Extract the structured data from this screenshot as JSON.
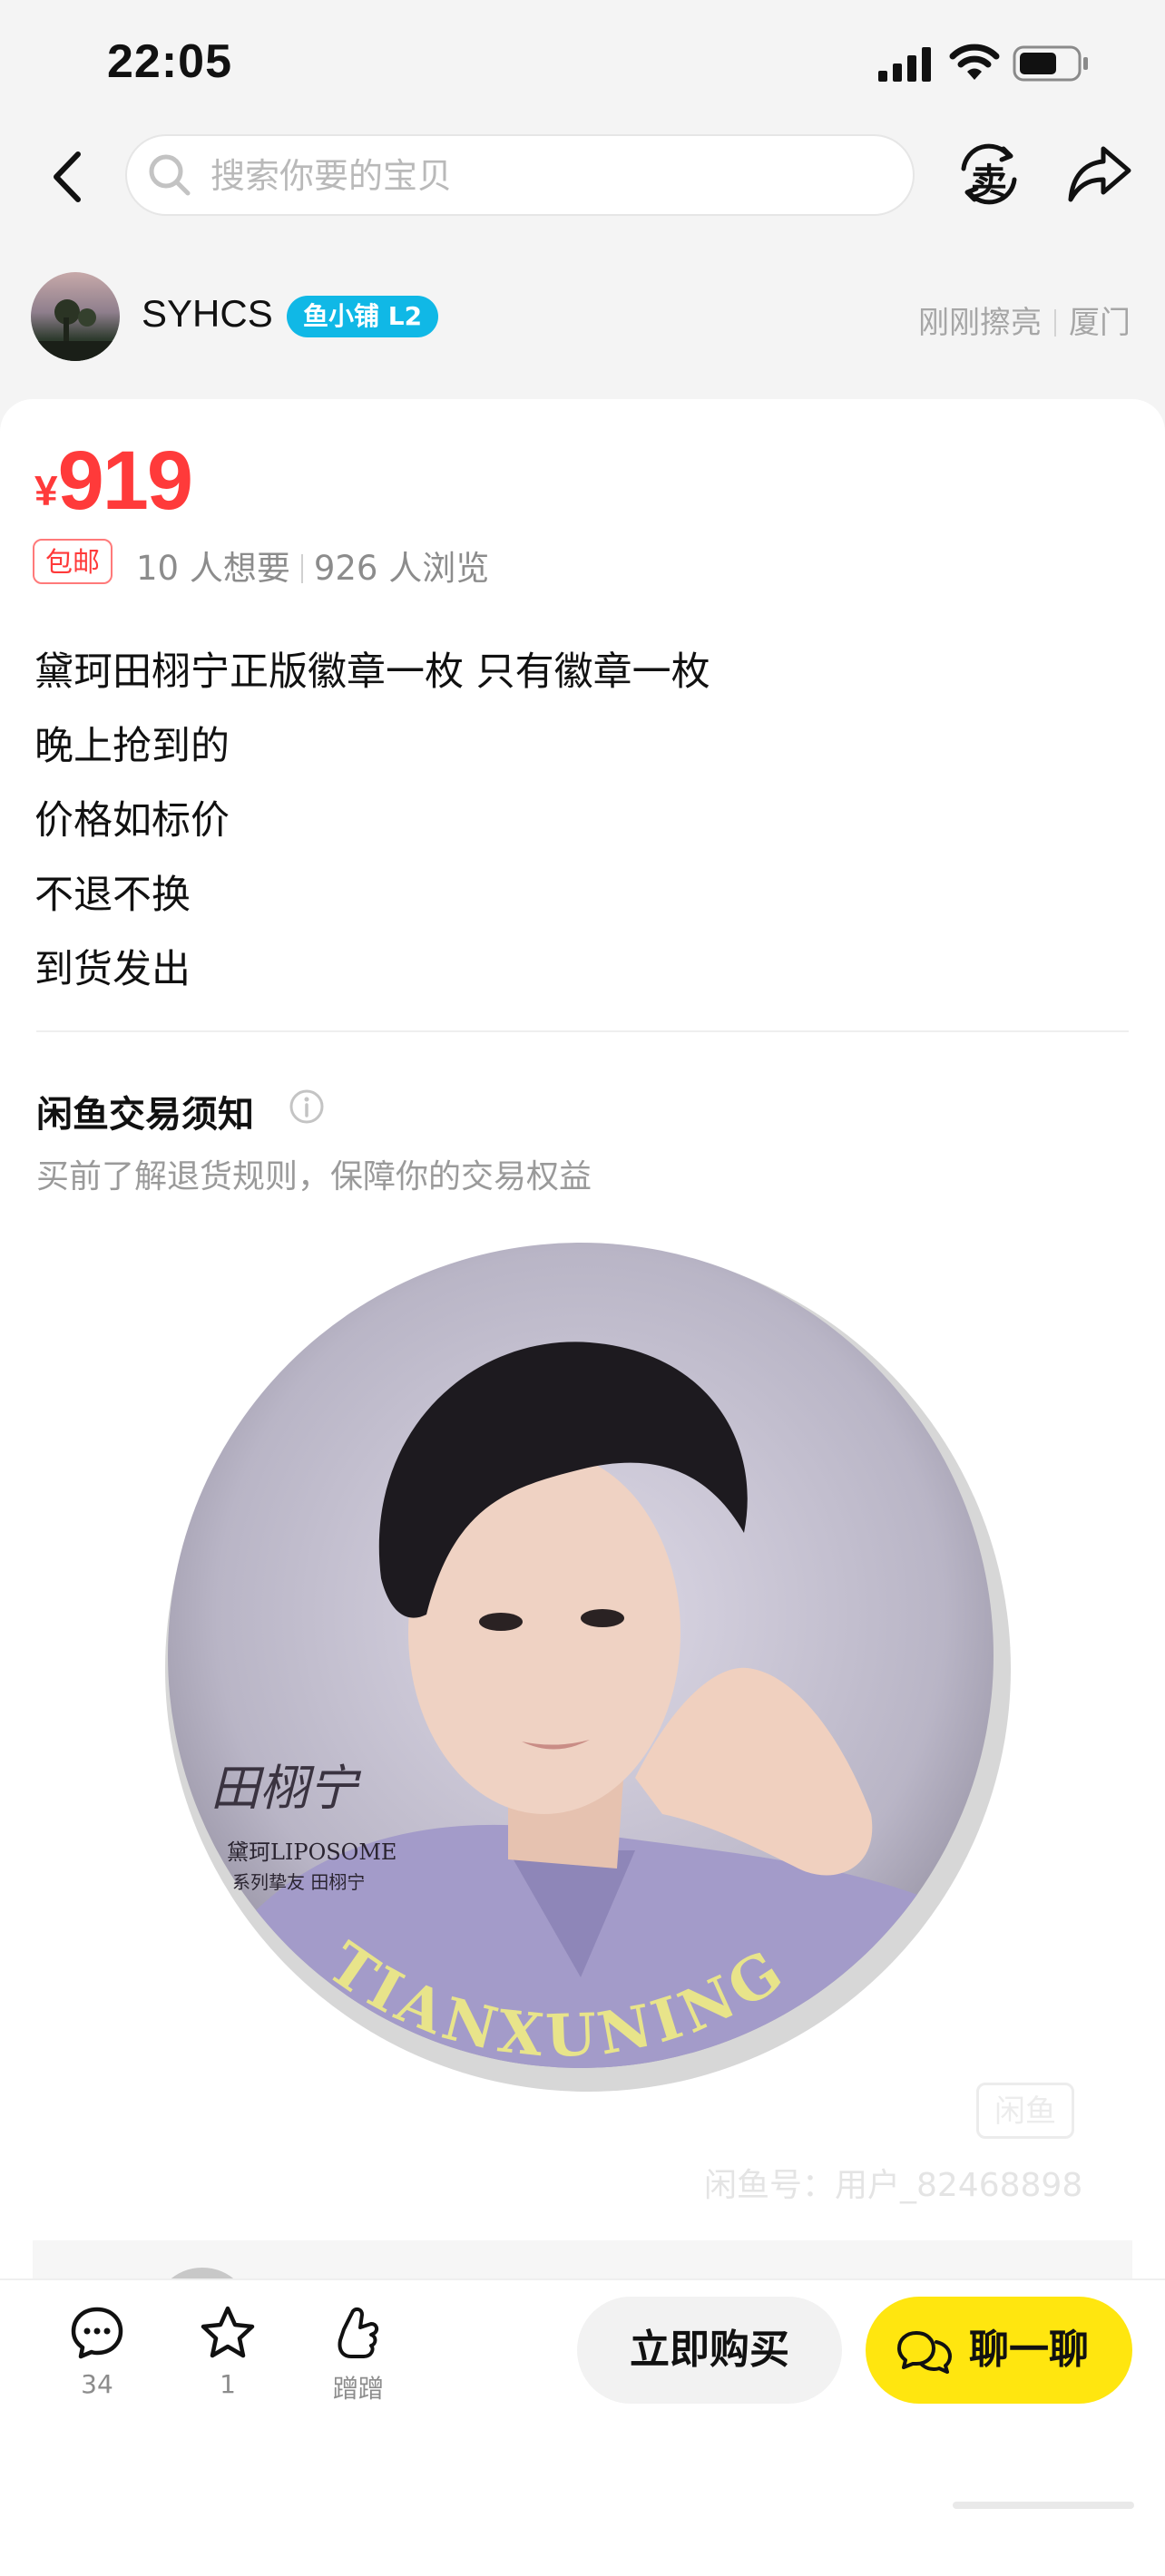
{
  "status_bar": {
    "time": "22:05"
  },
  "nav": {
    "search_placeholder": "搜索你要的宝贝",
    "sell_icon_text": "卖"
  },
  "seller": {
    "name": "SYHCS",
    "badge": "鱼小铺 L2",
    "refresh_status": "刚刚擦亮",
    "location": "厦门"
  },
  "product": {
    "currency": "¥",
    "price": "919",
    "shipping_tag": "包邮",
    "want_count": "10 人想要",
    "view_count": "926 人浏览",
    "description": [
      "黛珂田栩宁正版徽章一枚 只有徽章一枚",
      "晚上抢到的",
      "价格如标价",
      "不退不换",
      "到货发出"
    ]
  },
  "notice": {
    "title": "闲鱼交易须知",
    "subtitle": "买前了解退货规则，保障你的交易权益"
  },
  "photo": {
    "badge_signature": "田栩宁",
    "badge_line1": "黛珂LIPOSOME",
    "badge_line2": "系列挚友 田栩宁",
    "badge_arc_text": "TIANXUNING",
    "watermark_logo": "闲鱼",
    "watermark_id": "闲鱼号：用户_82468898"
  },
  "bottom_bar": {
    "comments_count": "34",
    "favorites_count": "1",
    "nudge_label": "蹭蹭",
    "buy_label": "立即购买",
    "chat_label": "聊一聊"
  },
  "colors": {
    "price_red": "#ff3a3a",
    "badge_blue": "#10b8e6",
    "chat_yellow": "#ffe60f"
  }
}
